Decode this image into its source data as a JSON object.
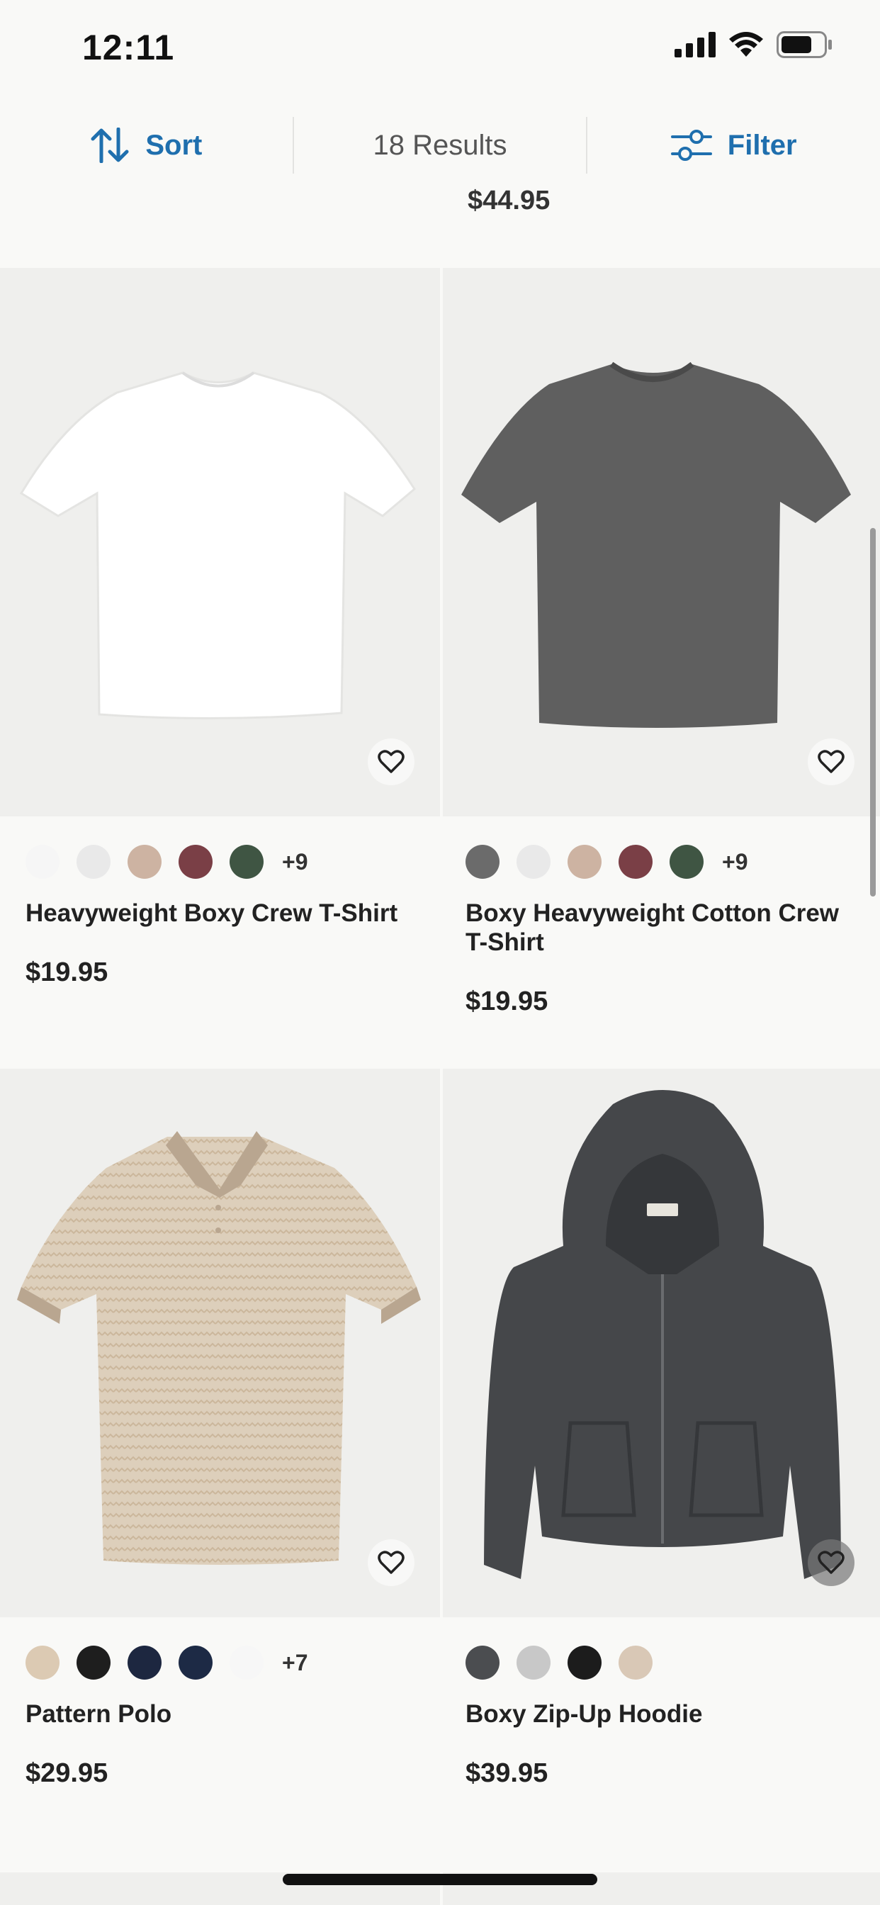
{
  "status_bar": {
    "time": "12:11"
  },
  "toolbar": {
    "sort_label": "Sort",
    "results_label": "18 Results",
    "filter_label": "Filter",
    "accent": "#1f6fae"
  },
  "previous_item": {
    "price": "$44.95"
  },
  "products": [
    {
      "name": "Heavyweight Boxy Crew T-Shirt",
      "price": "$19.95",
      "swatches": [
        "#f6f6f6",
        "#e9e9e9",
        "#cdb3a2",
        "#7a3f46",
        "#3f5543"
      ],
      "more": "+9",
      "garment_color": "#ffffff",
      "image": "white t-shirt"
    },
    {
      "name": "Boxy Heavyweight Cotton Crew T-Shirt",
      "price": "$19.95",
      "swatches": [
        "#6b6b6b",
        "#e9e9e9",
        "#cdb3a2",
        "#7a3f46",
        "#3f5543"
      ],
      "more": "+9",
      "garment_color": "#5f5f5f",
      "image": "charcoal t-shirt"
    },
    {
      "name": "Pattern Polo",
      "price": "$29.95",
      "swatches": [
        "#dccab3",
        "#1e1e1e",
        "#1d2740",
        "#1d2a45",
        "#f7f7f7"
      ],
      "more": "+7",
      "garment_color": "#ddcfbb",
      "image": "beige pattern polo"
    },
    {
      "name": "Boxy Zip-Up Hoodie",
      "price": "$39.95",
      "swatches": [
        "#4b4d50",
        "#c8c8c8",
        "#1c1c1c",
        "#d9c8b6"
      ],
      "more": "",
      "garment_color": "#45474a",
      "image": "charcoal zip-up hoodie"
    }
  ]
}
